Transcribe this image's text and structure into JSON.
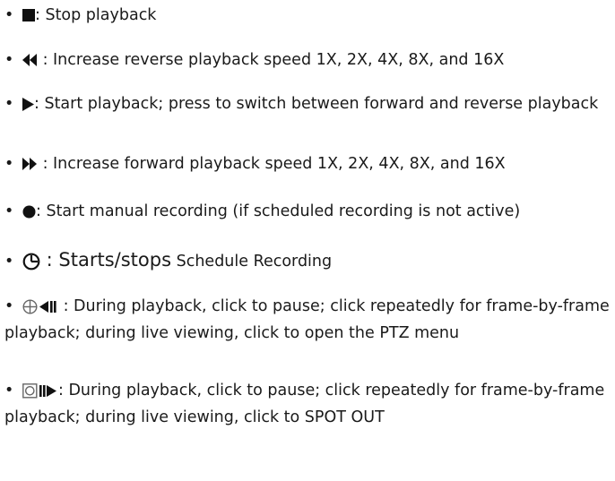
{
  "bullet": "•",
  "items": [
    {
      "icon": "stop-square-icon",
      "text": ": Stop playback"
    },
    {
      "icon": "rewind-icon",
      "text": " : Increase reverse playback speed 1X, 2X, 4X, 8X, and 16X"
    },
    {
      "icon": "play-icon",
      "text": ": Start playback; press to switch between forward and reverse playback"
    },
    {
      "icon": "fast-forward-icon",
      "text": " : Increase forward playback speed 1X, 2X, 4X, 8X, and 16X"
    },
    {
      "icon": "record-dot-icon",
      "text": ": Start manual recording (if scheduled recording is not active)"
    },
    {
      "icon": "schedule-clock-icon",
      "text_a": " : Starts/stops",
      "text_b": " Schedule Recording"
    },
    {
      "icon": "ptz-pause-icon",
      "text": " : During playback, click to pause; click repeatedly for frame-by-frame playback; during live viewing, click to open the PTZ menu"
    },
    {
      "icon": "spot-pause-icon",
      "text": ": During playback, click to pause; click repeatedly for frame-by-frame playback; during live viewing, click to SPOT OUT"
    }
  ]
}
